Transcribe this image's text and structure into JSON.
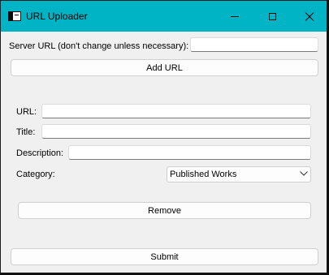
{
  "window": {
    "title": "URL Uploader"
  },
  "server": {
    "label": "Server URL (don't change unless necessary):",
    "value": ""
  },
  "add_url_label": "Add URL",
  "entry": {
    "url_label": "URL:",
    "url_value": "",
    "title_label": "Title:",
    "title_value": "",
    "description_label": "Description:",
    "description_value": "",
    "category_label": "Category:",
    "category_selected": "Published Works"
  },
  "remove_label": "Remove",
  "submit_label": "Submit"
}
